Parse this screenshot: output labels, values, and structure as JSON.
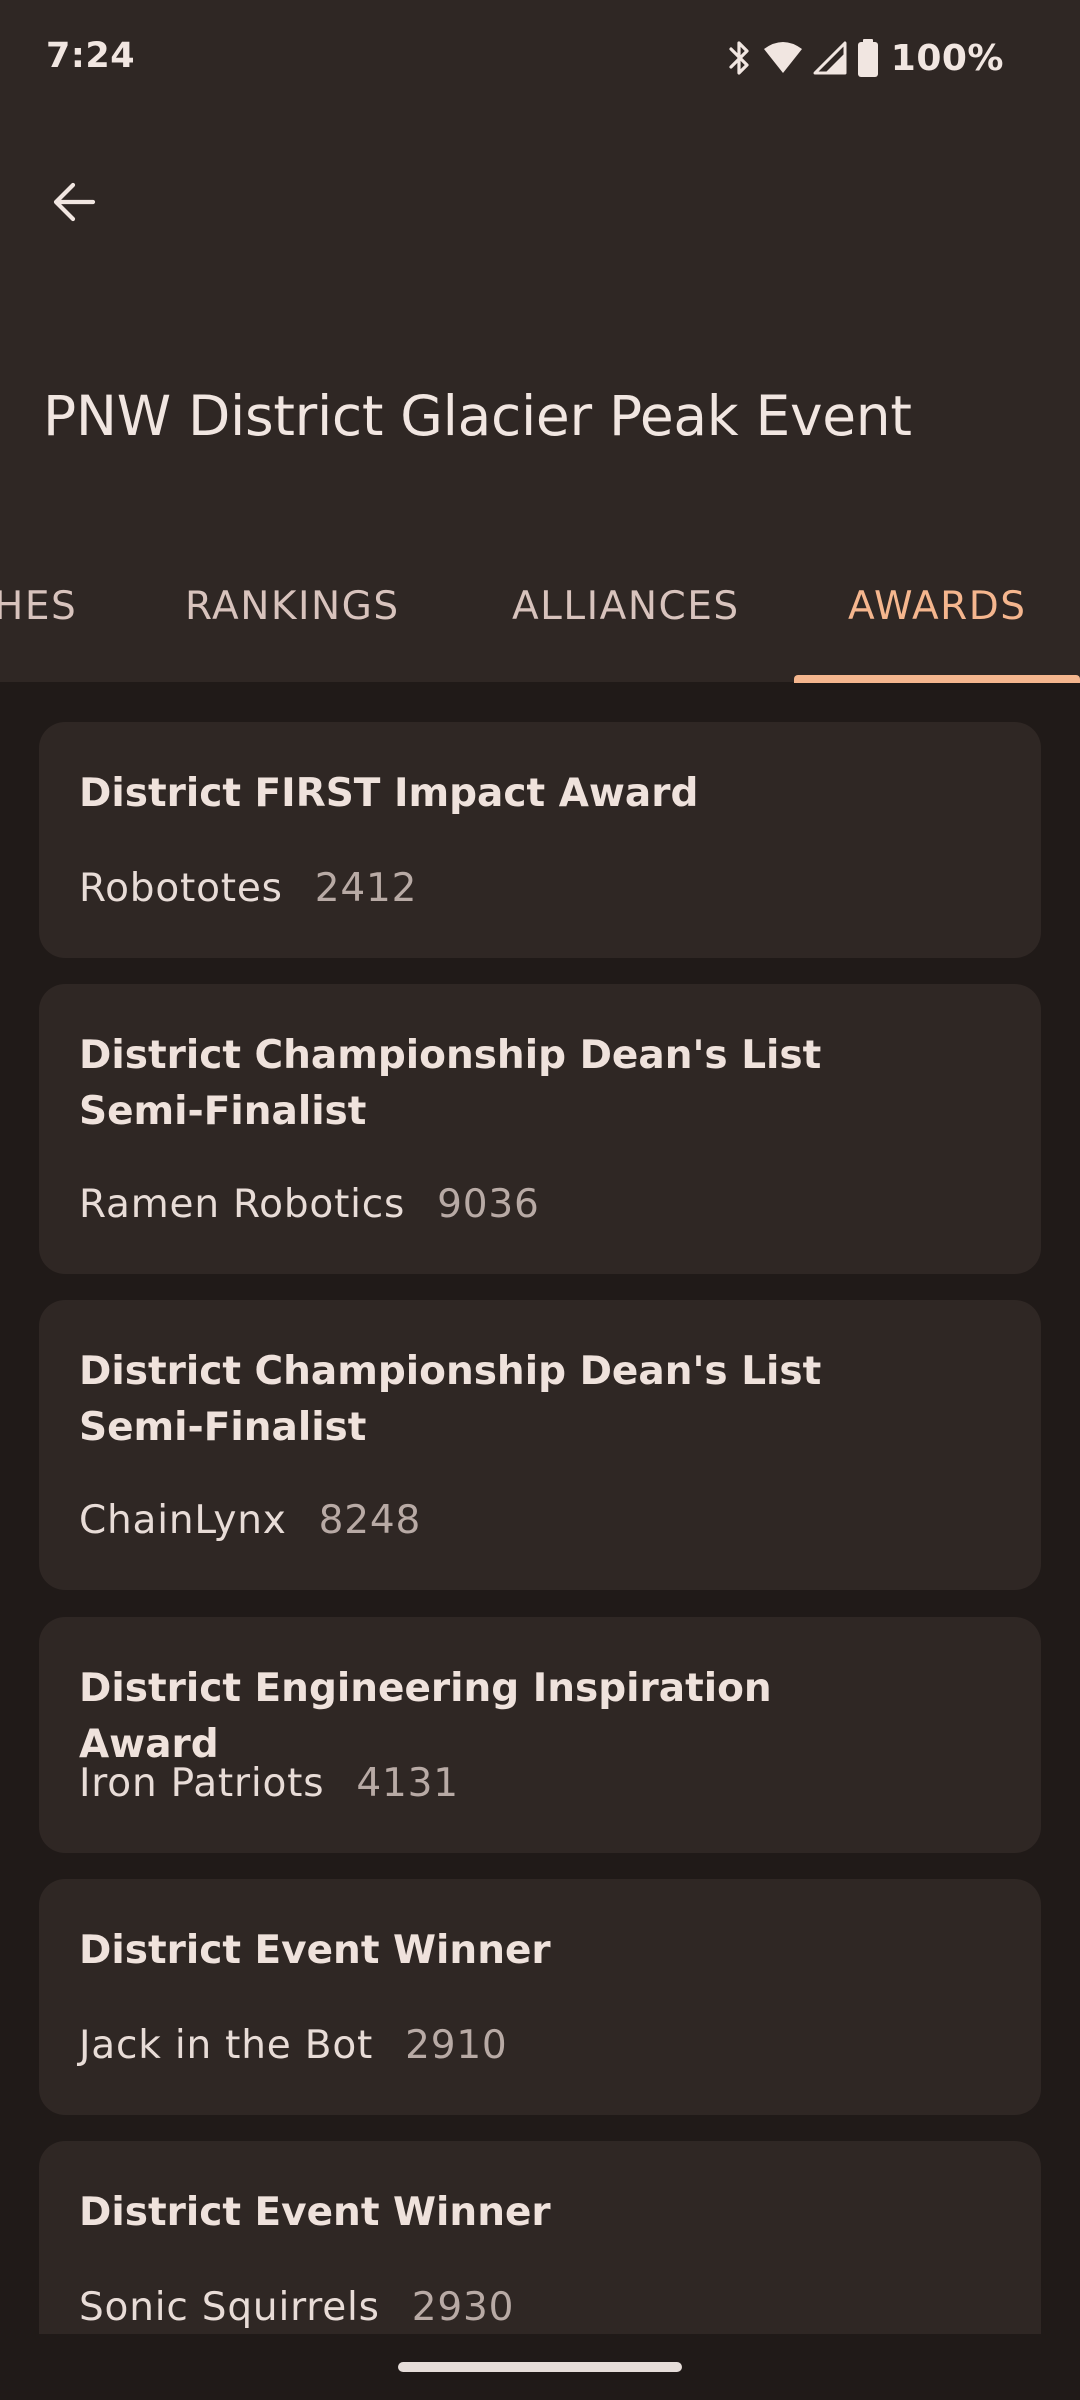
{
  "status_bar": {
    "time": "7:24",
    "battery_percent": "100%",
    "icons": [
      "bluetooth-icon",
      "wifi-icon",
      "cell-signal-icon",
      "battery-icon"
    ]
  },
  "app_bar": {
    "back_icon": "arrow-left-icon",
    "title": "PNW District Glacier Peak Event"
  },
  "tabs": {
    "items": [
      {
        "label": "HES"
      },
      {
        "label": "RANKINGS"
      },
      {
        "label": "ALLIANCES"
      },
      {
        "label": "AWARDS"
      }
    ],
    "active": "AWARDS"
  },
  "awards": [
    {
      "name": "District FIRST Impact Award",
      "team_name": "Robototes",
      "team_number": "2412"
    },
    {
      "name": "District Championship Dean's List Semi-Finalist",
      "team_name": "Ramen Robotics",
      "team_number": "9036"
    },
    {
      "name": "District Championship Dean's List Semi-Finalist",
      "team_name": "ChainLynx",
      "team_number": "8248"
    },
    {
      "name": "District Engineering Inspiration Award",
      "team_name": "Iron Patriots",
      "team_number": "4131"
    },
    {
      "name": "District Event Winner",
      "team_name": "Jack in the Bot",
      "team_number": "2910"
    },
    {
      "name": "District Event Winner",
      "team_name": "Sonic Squirrels",
      "team_number": "2930"
    }
  ],
  "colors": {
    "background": "#201a18",
    "surface": "#2f2724",
    "accent": "#f5b68e",
    "on_surface": "#efe2dc",
    "muted": "#b8aaa5"
  }
}
